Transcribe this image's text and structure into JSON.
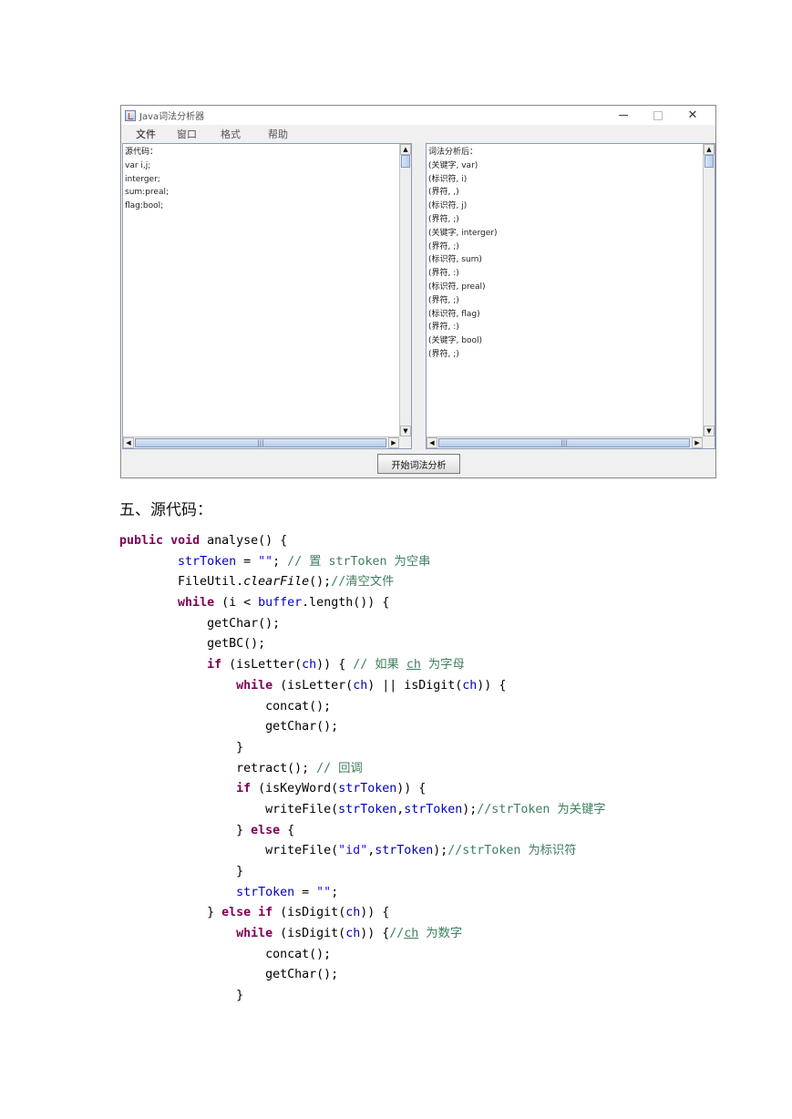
{
  "app_window": {
    "title": "Java词法分析器",
    "menu": [
      "文件",
      "窗口",
      "格式",
      "帮助"
    ],
    "left_text": [
      "源代码：",
      "var i,j;",
      "interger;",
      "sum:preal;",
      "flag:bool;"
    ],
    "right_text": [
      "词法分析后：",
      "(关键字, var)",
      "(标识符, i)",
      "(界符, ,)",
      "(标识符, j)",
      "(界符, ;)",
      "(关键字, interger)",
      "(界符, ;)",
      "(标识符, sum)",
      "(界符, :)",
      "(标识符, preal)",
      "(界符, ;)",
      "(标识符, flag)",
      "(界符, :)",
      "(关键字, bool)",
      "(界符, ;)"
    ],
    "analyze_button": "开始词法分析",
    "close_glyph": "✕"
  },
  "section_heading": "五、源代码：",
  "code_lines": [
    [
      {
        "t": "public",
        "c": "kw"
      },
      {
        "t": " "
      },
      {
        "t": "void",
        "c": "kw"
      },
      {
        "t": " analyse() {"
      }
    ],
    [
      {
        "t": "        "
      },
      {
        "t": "strToken",
        "c": "fld"
      },
      {
        "t": " = "
      },
      {
        "t": "\"\"",
        "c": "str"
      },
      {
        "t": "; "
      },
      {
        "t": "// 置 strToken 为空串",
        "c": "cm"
      }
    ],
    [
      {
        "t": "        FileUtil."
      },
      {
        "t": "clearFile",
        "c": "it"
      },
      {
        "t": "();"
      },
      {
        "t": "//清空文件",
        "c": "cm"
      }
    ],
    [
      {
        "t": "        "
      },
      {
        "t": "while",
        "c": "kw"
      },
      {
        "t": " (i < "
      },
      {
        "t": "buffer",
        "c": "fld"
      },
      {
        "t": ".length()) {"
      }
    ],
    [
      {
        "t": "            getChar();"
      }
    ],
    [
      {
        "t": "            getBC();"
      }
    ],
    [
      {
        "t": "            "
      },
      {
        "t": "if",
        "c": "kw"
      },
      {
        "t": " (isLetter("
      },
      {
        "t": "ch",
        "c": "fld"
      },
      {
        "t": ")) { "
      },
      {
        "t": "// 如果 ",
        "c": "cm"
      },
      {
        "t": "ch",
        "c": "cm u"
      },
      {
        "t": " 为字母",
        "c": "cm"
      }
    ],
    [
      {
        "t": "                "
      },
      {
        "t": "while",
        "c": "kw"
      },
      {
        "t": " (isLetter("
      },
      {
        "t": "ch",
        "c": "fld"
      },
      {
        "t": ") || isDigit("
      },
      {
        "t": "ch",
        "c": "fld"
      },
      {
        "t": ")) {"
      }
    ],
    [
      {
        "t": "                    concat();"
      }
    ],
    [
      {
        "t": "                    getChar();"
      }
    ],
    [
      {
        "t": "                }"
      }
    ],
    [
      {
        "t": "                retract(); "
      },
      {
        "t": "// 回调",
        "c": "cm"
      }
    ],
    [
      {
        "t": "                "
      },
      {
        "t": "if",
        "c": "kw"
      },
      {
        "t": " (isKeyWord("
      },
      {
        "t": "strToken",
        "c": "fld"
      },
      {
        "t": ")) {"
      }
    ],
    [
      {
        "t": "                    writeFile("
      },
      {
        "t": "strToken",
        "c": "fld"
      },
      {
        "t": ","
      },
      {
        "t": "strToken",
        "c": "fld"
      },
      {
        "t": ");"
      },
      {
        "t": "//strToken 为关键字",
        "c": "cm"
      }
    ],
    [
      {
        "t": "                } "
      },
      {
        "t": "else",
        "c": "kw"
      },
      {
        "t": " {"
      }
    ],
    [
      {
        "t": "                    writeFile("
      },
      {
        "t": "\"id\"",
        "c": "str"
      },
      {
        "t": ","
      },
      {
        "t": "strToken",
        "c": "fld"
      },
      {
        "t": ");"
      },
      {
        "t": "//strToken 为标识符",
        "c": "cm"
      }
    ],
    [
      {
        "t": "                }"
      }
    ],
    [
      {
        "t": "                "
      },
      {
        "t": "strToken",
        "c": "fld"
      },
      {
        "t": " = "
      },
      {
        "t": "\"\"",
        "c": "str"
      },
      {
        "t": ";"
      }
    ],
    [
      {
        "t": "            } "
      },
      {
        "t": "else",
        "c": "kw"
      },
      {
        "t": " "
      },
      {
        "t": "if",
        "c": "kw"
      },
      {
        "t": " (isDigit("
      },
      {
        "t": "ch",
        "c": "fld"
      },
      {
        "t": ")) {"
      }
    ],
    [
      {
        "t": "                "
      },
      {
        "t": "while",
        "c": "kw"
      },
      {
        "t": " (isDigit("
      },
      {
        "t": "ch",
        "c": "fld"
      },
      {
        "t": ")) {"
      },
      {
        "t": "//",
        "c": "cm"
      },
      {
        "t": "ch",
        "c": "cm u"
      },
      {
        "t": " 为数字",
        "c": "cm"
      }
    ],
    [
      {
        "t": "                    concat();"
      }
    ],
    [
      {
        "t": "                    getChar();"
      }
    ],
    [
      {
        "t": "                }"
      }
    ]
  ]
}
